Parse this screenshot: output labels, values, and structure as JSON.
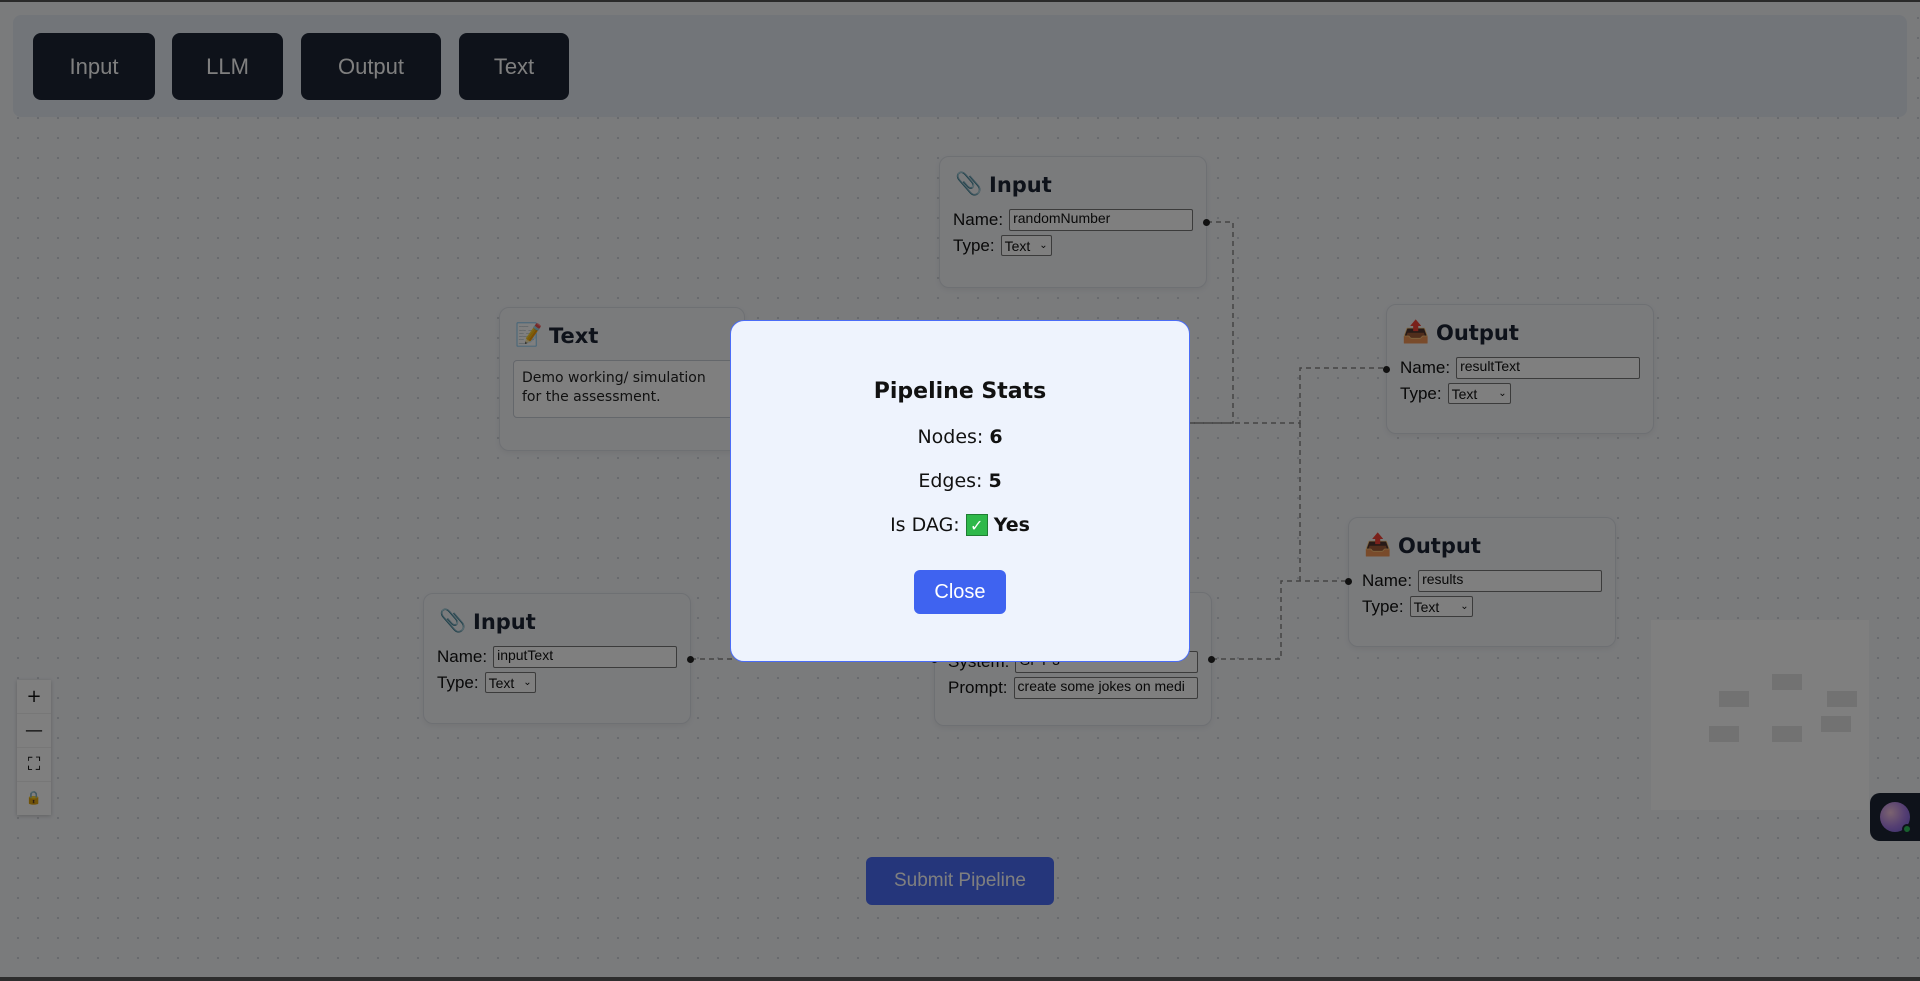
{
  "toolbar": {
    "buttons": [
      {
        "label": "Input"
      },
      {
        "label": "LLM"
      },
      {
        "label": "Output"
      },
      {
        "label": "Text"
      }
    ]
  },
  "nodes": {
    "input_top": {
      "title": "Input",
      "icon": "pin-icon",
      "name_label": "Name:",
      "name_value": "randomNumber",
      "type_label": "Type:",
      "type_value": "Text"
    },
    "text": {
      "title": "Text",
      "icon": "memo-icon",
      "text_value": "Demo working/ simulation for the assessment."
    },
    "output_top": {
      "title": "Output",
      "icon": "outbox-icon",
      "name_label": "Name:",
      "name_value": "resultText",
      "type_label": "Type:",
      "type_value": "Text"
    },
    "output_bottom": {
      "title": "Output",
      "icon": "outbox-icon",
      "name_label": "Name:",
      "name_value": "results",
      "type_label": "Type:",
      "type_value": "Text"
    },
    "input_bottom": {
      "title": "Input",
      "icon": "pin-icon",
      "name_label": "Name:",
      "name_value": "inputText",
      "type_label": "Type:",
      "type_value": "Text"
    },
    "llm": {
      "system_label": "System:",
      "system_value": "GPT-3",
      "prompt_label": "Prompt:",
      "prompt_value": "create some jokes on medi"
    }
  },
  "controls": {
    "zoom_in": "+",
    "zoom_out": "—",
    "fit": "⛶",
    "lock": "🔒"
  },
  "submit": {
    "label": "Submit Pipeline"
  },
  "modal": {
    "title": "Pipeline Stats",
    "nodes_label": "Nodes:",
    "nodes_value": "6",
    "edges_label": "Edges:",
    "edges_value": "5",
    "dag_label": "Is DAG:",
    "dag_value": "Yes",
    "close_label": "Close"
  },
  "colors": {
    "accent": "#4a6cf7",
    "toolbar_button": "#1c2434",
    "success": "#2eb84a"
  }
}
